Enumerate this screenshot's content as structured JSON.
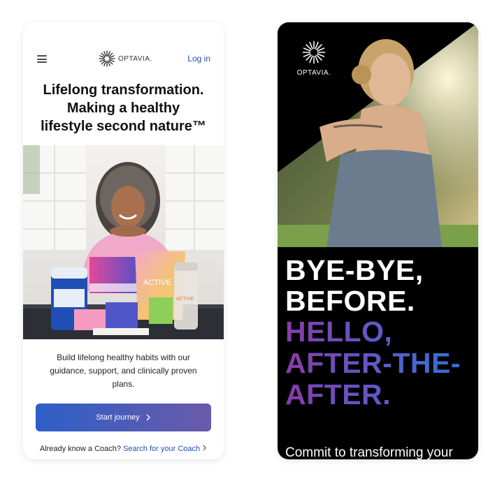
{
  "left_phone": {
    "brand": "OPTAVIA.",
    "login_label": "Log in",
    "headline_lines": [
      "Lifelong transformation.",
      "Making a healthy",
      "lifestyle second nature™"
    ],
    "body": "Build lifelong healthy habits with our guidance, support, and clinically proven plans.",
    "cta_label": "Start journey",
    "coach_prefix": "Already know a Coach?",
    "coach_link": "Search for your Coach",
    "product_labels": [
      "ACTIVE",
      "ACTIVE"
    ]
  },
  "right_phone": {
    "brand": "OPTAVIA.",
    "headline_white": [
      "BYE-BYE,",
      "BEFORE."
    ],
    "headline_gradient": [
      "HELLO,",
      "AFTER-THE-",
      "AFTER."
    ],
    "commit_text": "Commit to transforming your"
  },
  "colors": {
    "link_blue": "#1f4fb5",
    "cta_start": "#2d5fc8",
    "cta_end": "#6b5aa8",
    "grad_purple": "#8a3ba8",
    "grad_blue": "#2f72d6",
    "right_bg": "#000000"
  },
  "icons": {
    "menu": "hamburger-icon",
    "cta_arrow": "chevron-right-icon",
    "coach_arrow": "chevron-right-icon",
    "logo": "sunburst-logo-icon"
  }
}
